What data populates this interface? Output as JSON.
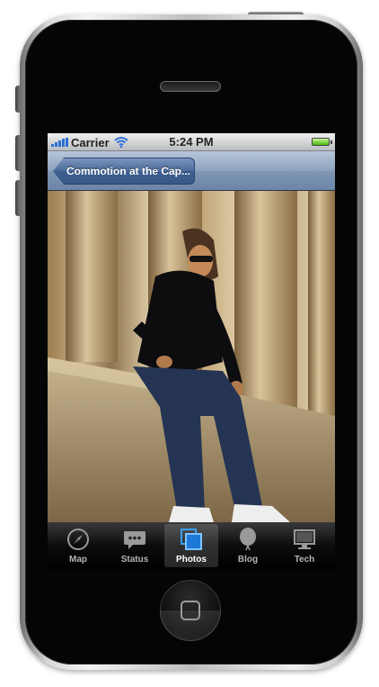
{
  "status_bar": {
    "carrier": "Carrier",
    "time": "5:24 PM"
  },
  "nav_bar": {
    "back_label": "Commotion at the Cap..."
  },
  "photo": {
    "subject": "photo"
  },
  "tab_bar": {
    "selected": "Photos",
    "items": [
      {
        "label": "Map",
        "icon": "compass-icon"
      },
      {
        "label": "Status",
        "icon": "speech-bubble-icon"
      },
      {
        "label": "Photos",
        "icon": "photos-icon"
      },
      {
        "label": "Blog",
        "icon": "balloon-icon"
      },
      {
        "label": "Tech",
        "icon": "monitor-icon"
      }
    ]
  },
  "colors": {
    "nav_bar": "#8ea3bf",
    "back_button": "#4a6a98",
    "signal": "#2b6fd6",
    "battery": "#47b80b"
  }
}
